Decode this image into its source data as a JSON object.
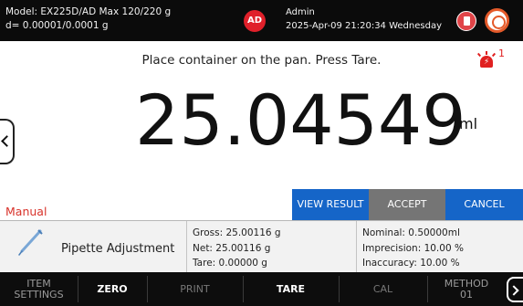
{
  "header": {
    "model_line": "Model: EX225D/AD   Max 120/220 g",
    "resolution_line": "d= 0.00001/0.0001 g",
    "avatar_initials": "AD",
    "user_name": "Admin",
    "datetime": "2025-Apr-09 21:20:34 Wednesday",
    "icons": [
      "usb-drive-icon",
      "power-icon"
    ]
  },
  "instruction": "Place container on the pan. Press Tare.",
  "alarm": {
    "icon": "alarm-icon",
    "count": "1",
    "color": "#e02020"
  },
  "readout": {
    "value": "25.04549",
    "unit": "ml"
  },
  "mode": "Manual",
  "actions": {
    "view_result": "VIEW RESULT",
    "accept": "ACCEPT",
    "cancel": "CANCEL"
  },
  "info": {
    "task_icon": "pipette-icon",
    "task_name": "Pipette Adjustment",
    "gross": "Gross: 25.00116  g",
    "net": "Net: 25.00116  g",
    "tare": "Tare: 0.00000  g",
    "nominal": "Nominal: 0.50000ml",
    "imprecision": "Imprecision: 10.00 %",
    "inaccuracy": "Inaccuracy: 10.00 %"
  },
  "toolbar": {
    "item_settings_1": "ITEM",
    "item_settings_2": "SETTINGS",
    "zero": "ZERO",
    "print": "PRINT",
    "tare": "TARE",
    "cal": "CAL",
    "method_1": "METHOD",
    "method_2": "01"
  },
  "colors": {
    "accent_blue": "#1565c8",
    "accept_gray": "#757575",
    "mode_red": "#d8322a",
    "header_bg": "#0b0b0b"
  }
}
